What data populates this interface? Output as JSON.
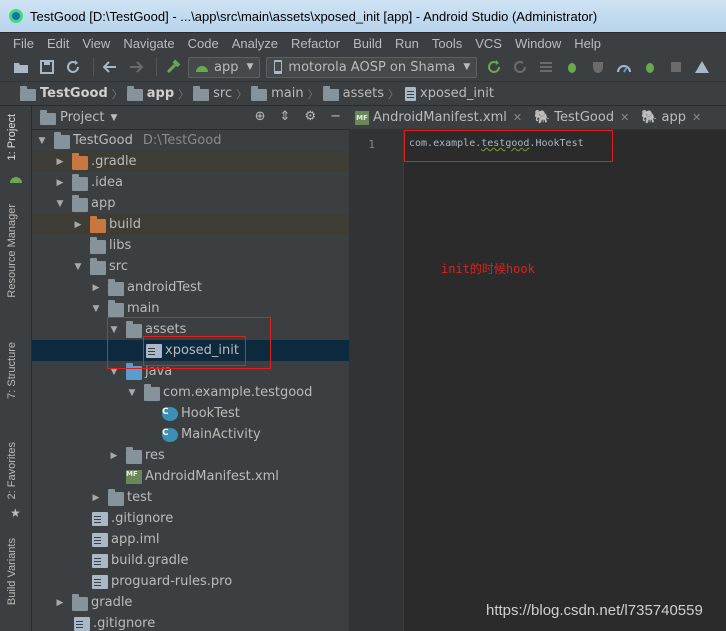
{
  "window": {
    "title": "TestGood [D:\\TestGood] - ...\\app\\src\\main\\assets\\xposed_init [app] - Android Studio (Administrator)"
  },
  "menu": [
    "File",
    "Edit",
    "View",
    "Navigate",
    "Code",
    "Analyze",
    "Refactor",
    "Build",
    "Run",
    "Tools",
    "VCS",
    "Window",
    "Help"
  ],
  "toolbar": {
    "config": "app",
    "device": "motorola AOSP on Shama"
  },
  "breadcrumb": [
    "TestGood",
    "app",
    "src",
    "main",
    "assets",
    "xposed_init"
  ],
  "side_tabs": [
    "1: Project",
    "Resource Manager",
    "7: Structure",
    "2: Favorites",
    "Build Variants"
  ],
  "project": {
    "label": "Project",
    "tree": [
      {
        "label": "TestGood",
        "path": "D:\\TestGood"
      },
      {
        "label": ".gradle"
      },
      {
        "label": ".idea"
      },
      {
        "label": "app"
      },
      {
        "label": "build"
      },
      {
        "label": "libs"
      },
      {
        "label": "src"
      },
      {
        "label": "androidTest"
      },
      {
        "label": "main"
      },
      {
        "label": "assets"
      },
      {
        "label": "xposed_init"
      },
      {
        "label": "java"
      },
      {
        "label": "com.example.testgood"
      },
      {
        "label": "HookTest"
      },
      {
        "label": "MainActivity"
      },
      {
        "label": "res"
      },
      {
        "label": "AndroidManifest.xml"
      },
      {
        "label": "test"
      },
      {
        "label": ".gitignore"
      },
      {
        "label": "app.iml"
      },
      {
        "label": "build.gradle"
      },
      {
        "label": "proguard-rules.pro"
      },
      {
        "label": "gradle"
      },
      {
        "label": ".gitignore"
      }
    ]
  },
  "editor": {
    "tabs": [
      "AndroidManifest.xml",
      "TestGood",
      "app"
    ],
    "line_number": "1",
    "code": {
      "prefix": "com.example.",
      "squiggle": "testgood",
      "suffix": ".HookTest"
    },
    "annotation": "init的时候hook"
  },
  "watermark": "https://blog.csdn.net/l735740559"
}
